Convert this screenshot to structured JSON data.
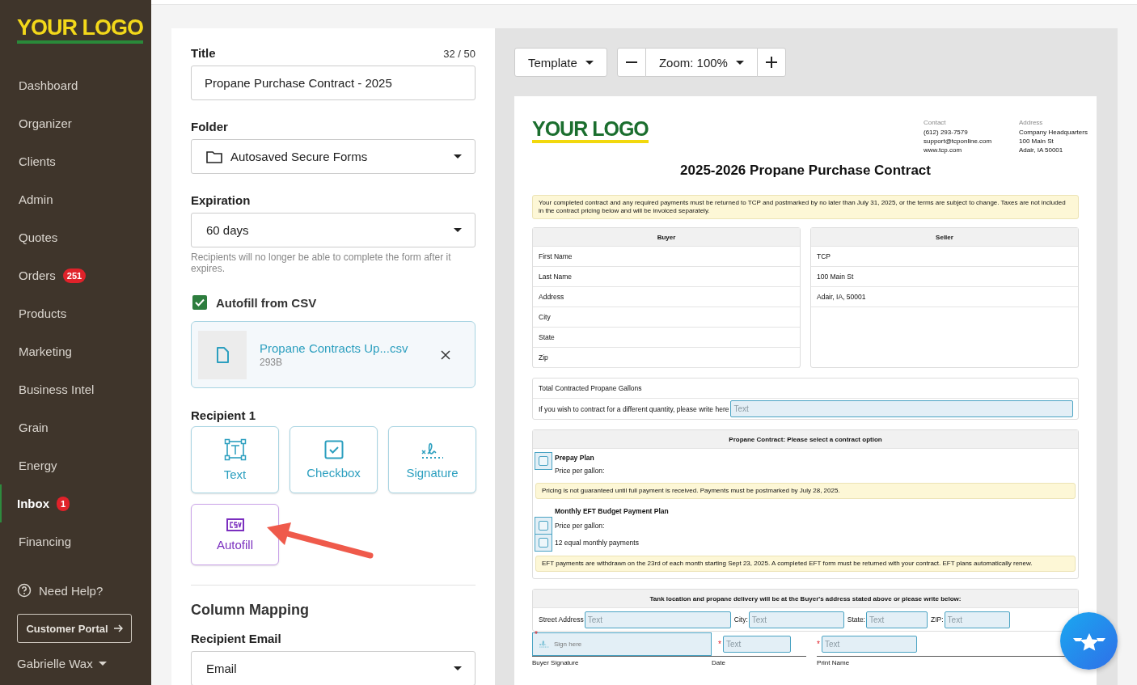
{
  "sidebar": {
    "logo": "YOUR LOGO",
    "items": [
      {
        "label": "Dashboard",
        "selected": false
      },
      {
        "label": "Organizer",
        "selected": false
      },
      {
        "label": "Clients",
        "selected": false
      },
      {
        "label": "Admin",
        "selected": false
      },
      {
        "label": "Quotes",
        "selected": false
      },
      {
        "label": "Orders",
        "badge": "251",
        "selected": false
      },
      {
        "label": "Products",
        "selected": false
      },
      {
        "label": "Marketing",
        "selected": false
      },
      {
        "label": "Business Intel",
        "selected": false
      },
      {
        "label": "Grain",
        "selected": false
      },
      {
        "label": "Energy",
        "selected": false
      },
      {
        "label": "Inbox",
        "badge": "1",
        "selected": true
      },
      {
        "label": "Financing",
        "selected": false
      }
    ],
    "help": "Need Help?",
    "portal_button": "Customer Portal",
    "user": "Gabrielle Wax"
  },
  "form": {
    "title_label": "Title",
    "title_count": "32 / 50",
    "title_value": "Propane Purchase Contract - 2025",
    "folder_label": "Folder",
    "folder_value": "Autosaved Secure Forms",
    "expiration_label": "Expiration",
    "expiration_value": "60 days",
    "expiration_hint": "Recipients will no longer be able to complete the form after it expires.",
    "autofill": {
      "label": "Autofill from CSV",
      "checked": true
    },
    "file": {
      "name": "Propane Contracts Up...csv",
      "size": "293B"
    },
    "recipient_label": "Recipient 1",
    "field_types": [
      {
        "label": "Text",
        "kind": "text"
      },
      {
        "label": "Checkbox",
        "kind": "checkbox"
      },
      {
        "label": "Signature",
        "kind": "signature"
      },
      {
        "label": "Autofill",
        "kind": "csv"
      }
    ],
    "column_mapping_heading": "Column Mapping",
    "recipient_email_label": "Recipient Email",
    "recipient_email_value": "Email"
  },
  "toolbar": {
    "template": "Template",
    "zoom": "Zoom: 100%"
  },
  "document": {
    "logo": "YOUR LOGO",
    "contact": {
      "label": "Contact",
      "lines": [
        "(612) 293-7579",
        "support@tcponline.com",
        "www.tcp.com"
      ]
    },
    "address": {
      "label": "Address",
      "lines": [
        "Company Headquarters",
        "100 Main St",
        "Adair, IA 50001"
      ]
    },
    "heading": "2025-2026 Propane Purchase Contract",
    "notice": "Your completed contract and any required payments must be returned to TCP and postmarked by no later than July 31, 2025, or the terms are subject to change. Taxes are not included in the contract pricing below and will be invoiced separately.",
    "buyer": {
      "heading": "Buyer",
      "rows": [
        "First Name",
        "Last Name",
        "Address",
        "City",
        "State",
        "Zip"
      ]
    },
    "seller": {
      "heading": "Seller",
      "rows": [
        "TCP",
        "100 Main St",
        "Adair, IA, 50001"
      ]
    },
    "gallons": {
      "label": "Total Contracted Propane Gallons",
      "prompt": "If you wish to contract for a different quantity, please write here",
      "placeholder": "Text"
    },
    "contract": {
      "heading": "Propane Contract: Please select a contract option",
      "items": [
        {
          "kind": "option",
          "title": "Prepay Plan",
          "text": "Price per gallon:",
          "checked": false
        },
        {
          "kind": "notice",
          "text": "Pricing is not guaranteed until full payment is received. Payments must be postmarked by July 28, 2025."
        },
        {
          "kind": "title",
          "text": "Monthly EFT Budget Payment Plan"
        },
        {
          "kind": "check",
          "text": "Price per gallon:",
          "checked": false
        },
        {
          "kind": "check",
          "text": "12 equal monthly payments",
          "checked": false
        },
        {
          "kind": "notice",
          "text": "EFT payments are withdrawn on the 23rd of each month starting Sept 23, 2025. A completed EFT form must be returned with your contract. EFT plans automatically renew."
        }
      ]
    },
    "delivery": {
      "heading": "Tank location and propane delivery will be at the Buyer's address stated above or please write below:",
      "fields": [
        {
          "label": "Street Address",
          "placeholder": "Text"
        },
        {
          "label": "City:",
          "placeholder": "Text"
        },
        {
          "label": "State:",
          "placeholder": "Text"
        },
        {
          "label": "ZIP:",
          "placeholder": "Text"
        }
      ]
    },
    "signatures": [
      {
        "kind": "signature",
        "placeholder": "Sign here",
        "label": "Buyer Signature",
        "required_mark": "*"
      },
      {
        "kind": "text",
        "placeholder": "Text",
        "label": "Date",
        "required_mark": "*"
      },
      {
        "kind": "text",
        "placeholder": "Text",
        "label": "Print Name",
        "required_mark": "*"
      }
    ]
  }
}
